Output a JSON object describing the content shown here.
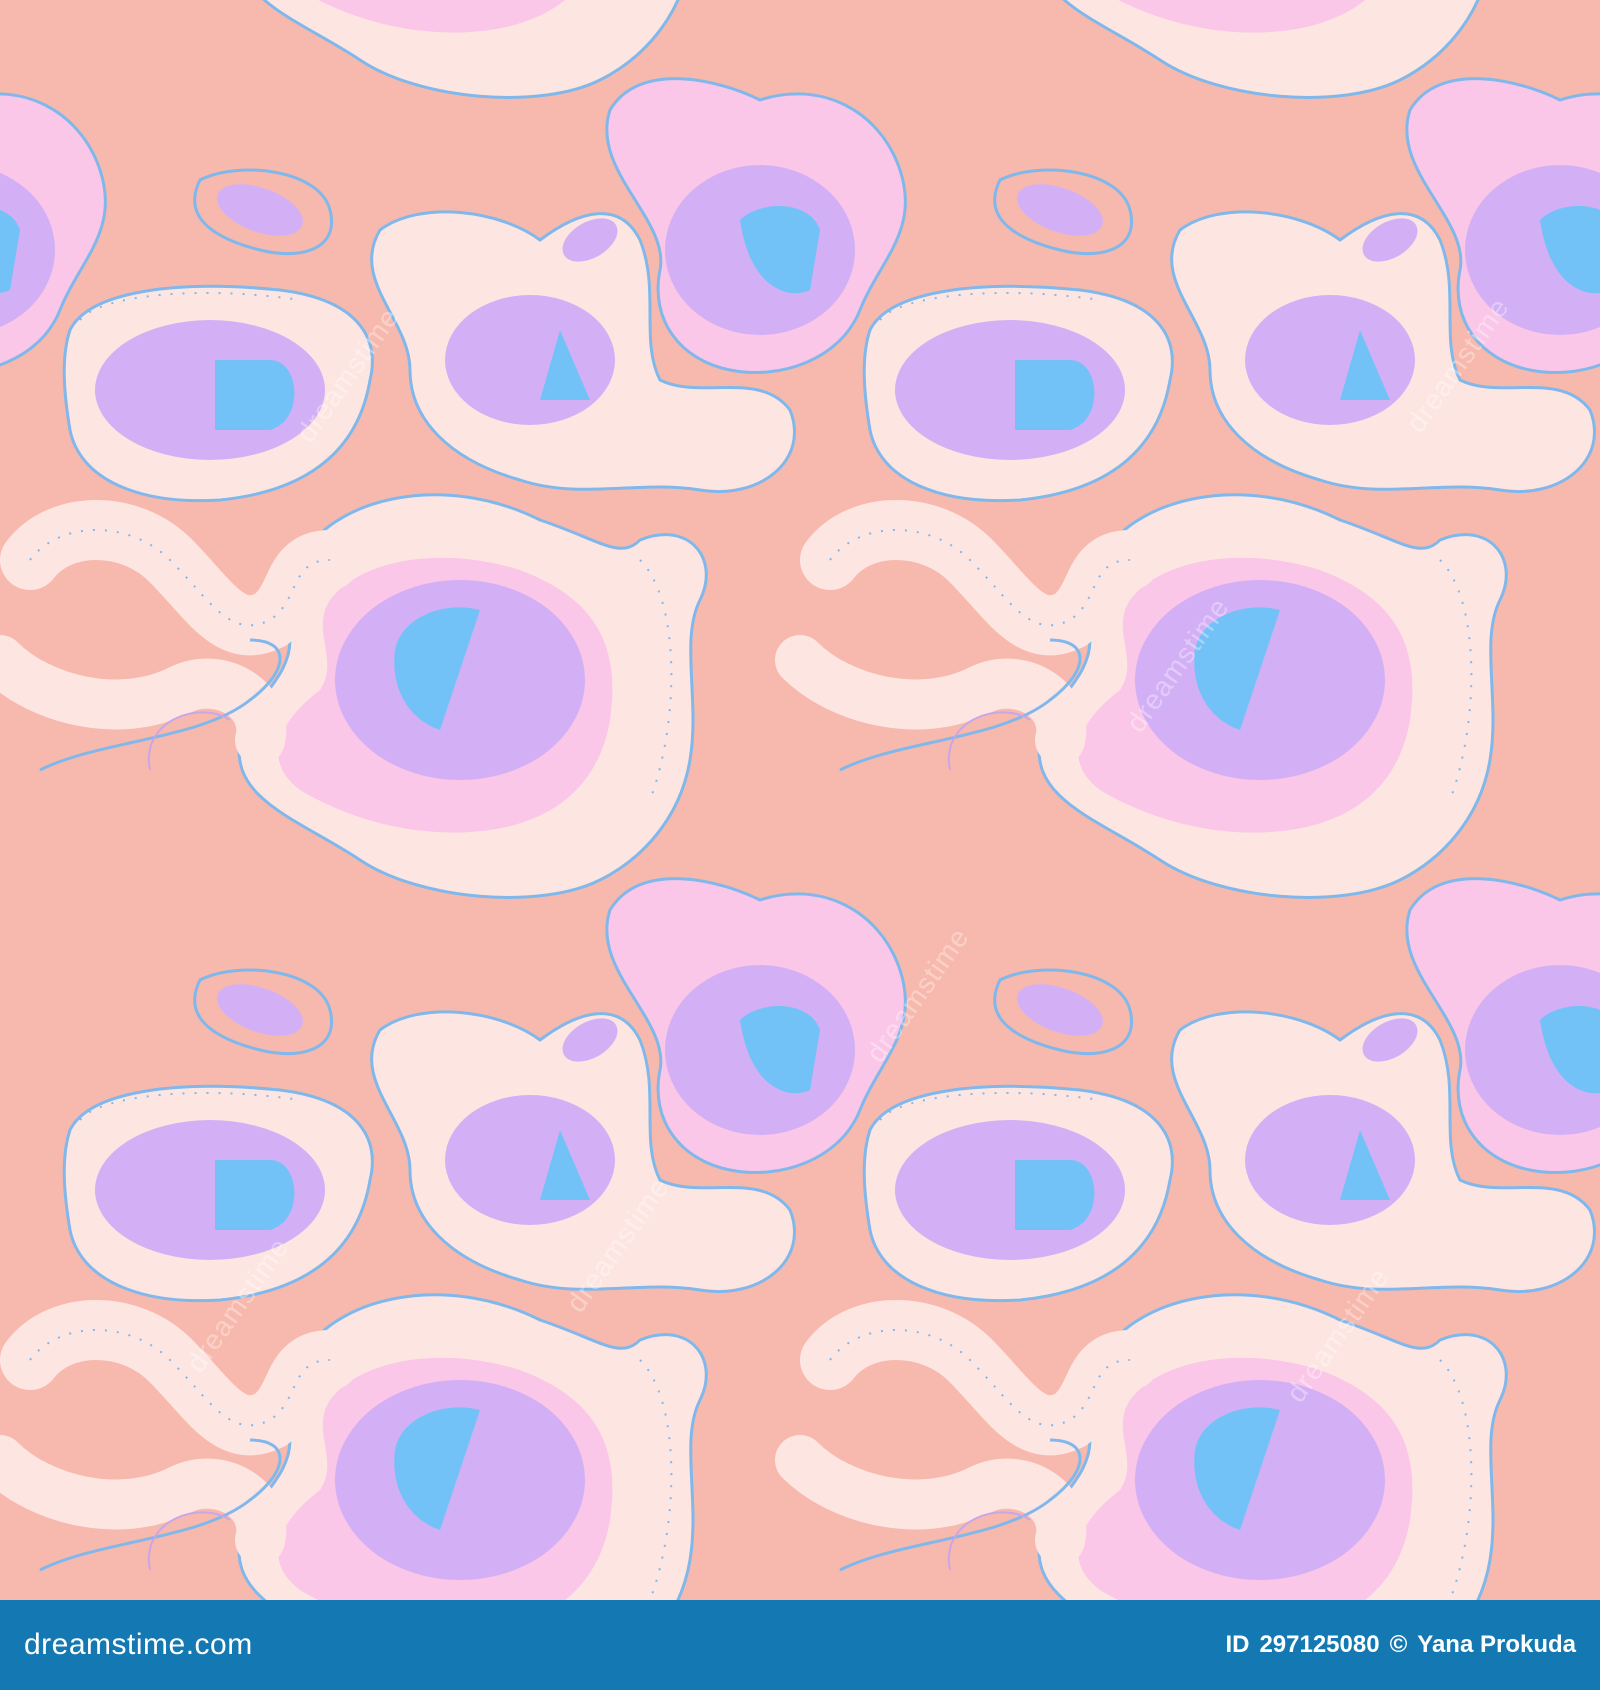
{
  "image": {
    "watermark_text": "dreamstime",
    "palette": {
      "background": "#f7b9ad",
      "cream": "#fde6e2",
      "pink": "#fbc7e8",
      "lavender": "#d3b0f5",
      "blue": "#72c2f8",
      "outline": "#80b8ec",
      "footer": "#1479b2"
    }
  },
  "footer": {
    "logo_text": "dreamstime.com",
    "id_label": "ID",
    "id_value": "297125080",
    "copyright_symbol": "©",
    "author": "Yana Prokuda"
  }
}
